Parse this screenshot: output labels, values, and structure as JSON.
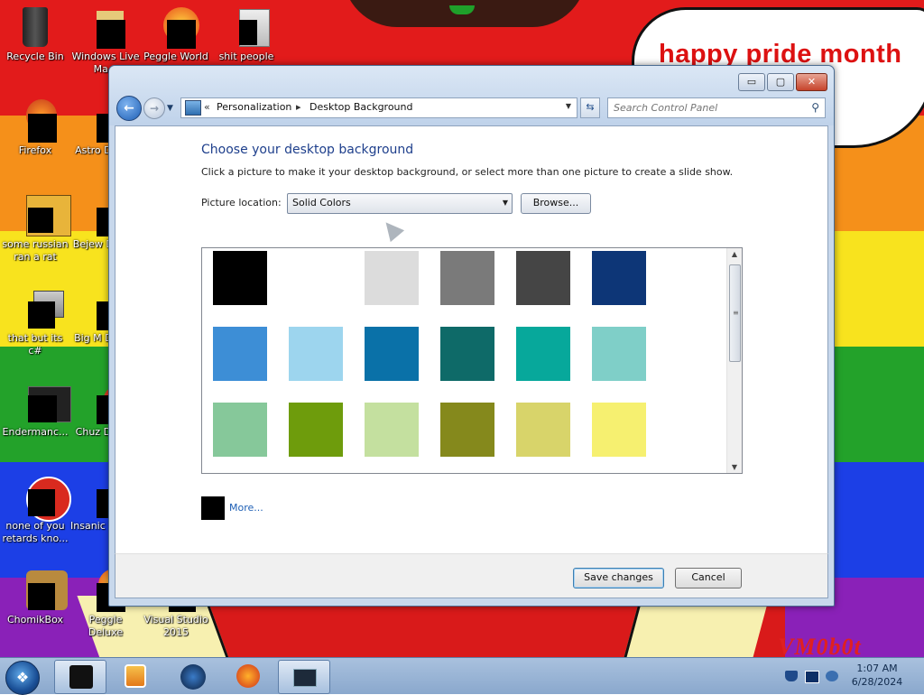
{
  "desktop": {
    "banner_text": "happy pride month",
    "watermark": "VM0b0t",
    "icons": [
      {
        "label": "Recycle Bin"
      },
      {
        "label": "Windows Live Ma..."
      },
      {
        "label": "Peggle World"
      },
      {
        "label": "shit people"
      },
      {
        "label": "Firefox"
      },
      {
        "label": "Astro Delu..."
      },
      {
        "label": "some russian ran a rat"
      },
      {
        "label": "Bejew Delu..."
      },
      {
        "label": "that but its c#"
      },
      {
        "label": "Big M Delu..."
      },
      {
        "label": "Endermanc..."
      },
      {
        "label": "Chuz Delu..."
      },
      {
        "label": "none of you retards kno..."
      },
      {
        "label": "Insanic Delu..."
      },
      {
        "label": "ChomikBox"
      },
      {
        "label": "Peggle Deluxe"
      },
      {
        "label": "Visual Studio 2015"
      }
    ]
  },
  "window": {
    "controls": {
      "minimize": "▭",
      "maximize": "▢",
      "close": "✕"
    },
    "address": {
      "separator": "«",
      "crumbs": [
        "Personalization",
        "Desktop Background"
      ],
      "arrow": "▸"
    },
    "search": {
      "placeholder": "Search Control Panel"
    },
    "heading": "Choose your desktop background",
    "subheading": "Click a picture to make it your desktop background, or select more than one picture to create a slide show.",
    "picture_location": {
      "label": "Picture location:",
      "value": "Solid Colors"
    },
    "browse_label": "Browse...",
    "swatches": [
      "#000000",
      "#ffffff",
      "#dcdcdc",
      "#7a7a7a",
      "#454545",
      "#0d3677",
      "#3d8ed6",
      "#9dd5ee",
      "#0a71a8",
      "#0e6a68",
      "#07a89b",
      "#7fcfc8",
      "#86c89a",
      "#6e9c0c",
      "#c4e09f",
      "#85891c",
      "#d8d46a",
      "#f6f070"
    ],
    "more_label": "More...",
    "save_label": "Save changes",
    "cancel_label": "Cancel"
  },
  "taskbar": {
    "time": "1:07 AM",
    "date": "6/28/2024"
  }
}
